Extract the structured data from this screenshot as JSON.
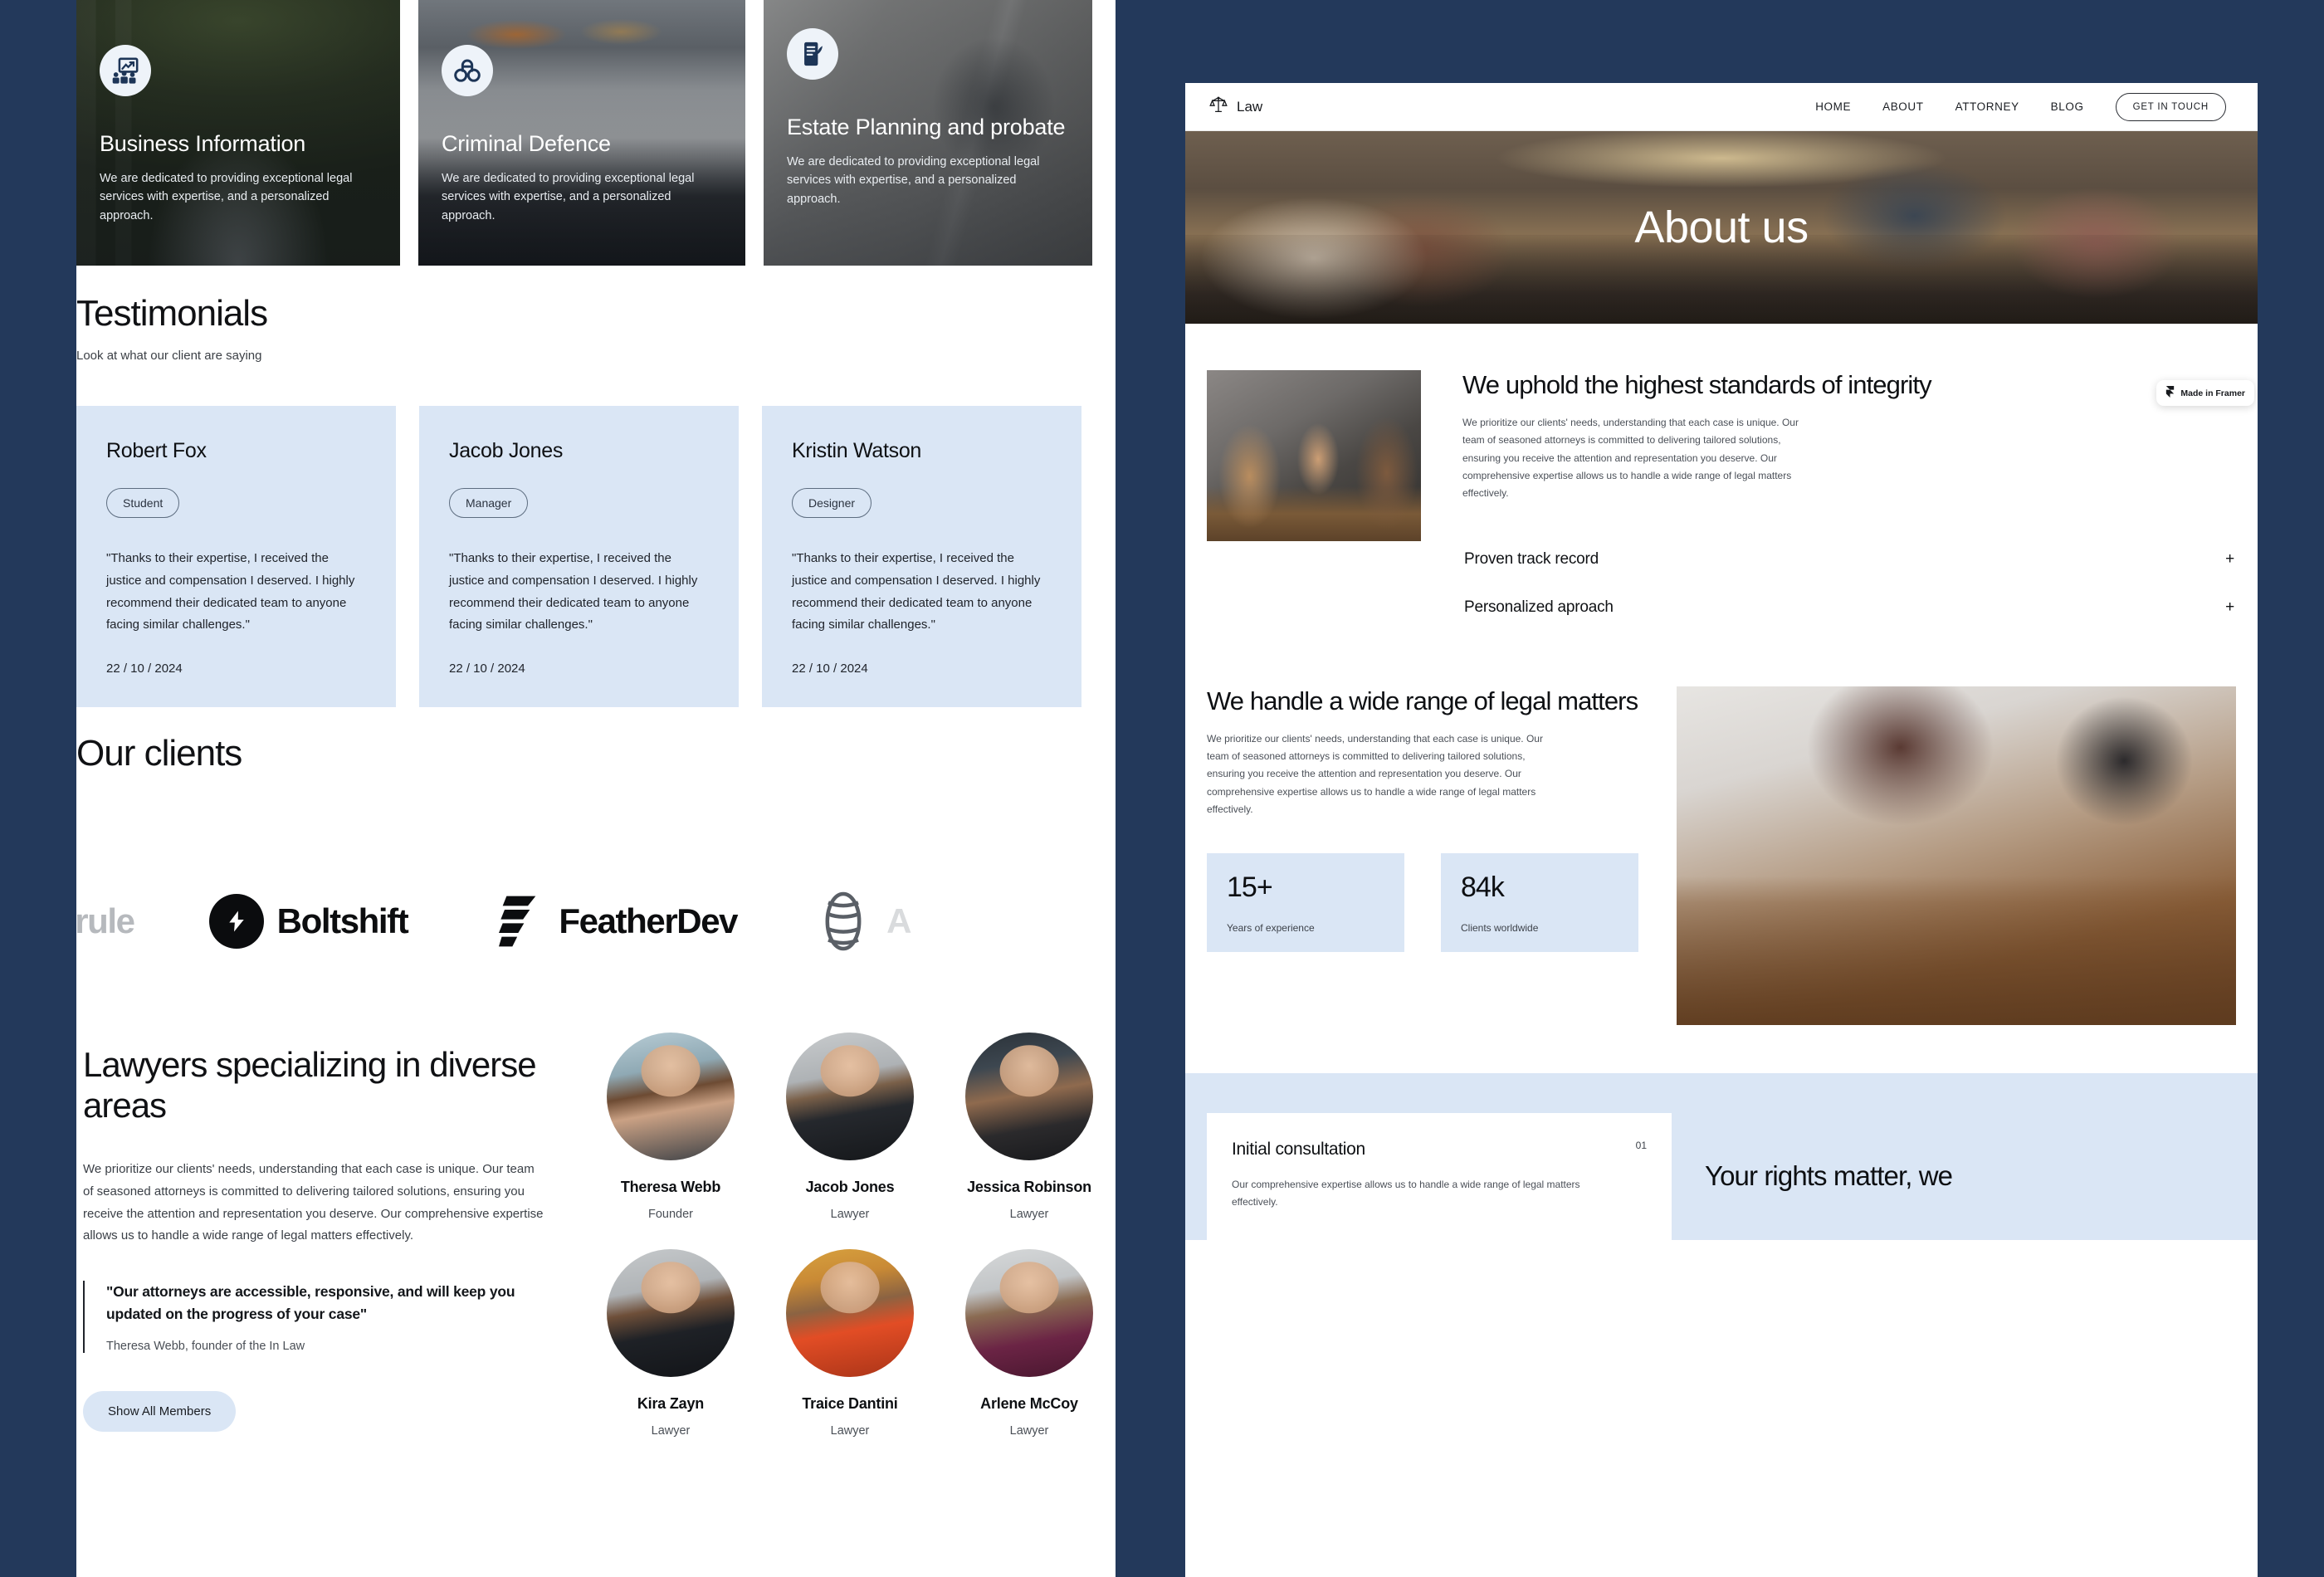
{
  "left_page": {
    "services": [
      {
        "icon": "chart-presentation-people-icon",
        "title": "Business Information",
        "description": "We are dedicated to providing exceptional legal services with expertise, and a personalized approach."
      },
      {
        "icon": "handcuffs-icon",
        "title": "Criminal Defence",
        "description": "We are dedicated to providing exceptional legal services with expertise, and a personalized approach."
      },
      {
        "icon": "signed-document-pen-icon",
        "title": "Estate Planning and probate",
        "description": "We are dedicated to providing exceptional legal services with expertise, and a personalized approach."
      }
    ],
    "testimonials": {
      "heading": "Testimonials",
      "subheading": "Look at what our client are saying",
      "cards": [
        {
          "name": "Robert Fox",
          "role": "Student",
          "quote": "\"Thanks to their expertise, I received the justice and compensation I deserved. I highly recommend their dedicated team to anyone facing similar challenges.\"",
          "date": "22 / 10 / 2024"
        },
        {
          "name": "Jacob Jones",
          "role": "Manager",
          "quote": "\"Thanks to their expertise, I received the justice and compensation I deserved. I highly recommend their dedicated team to anyone facing similar challenges.\"",
          "date": "22 / 10 / 2024"
        },
        {
          "name": "Kristin Watson",
          "role": "Designer",
          "quote": "\"Thanks to their expertise, I received the justice and compensation I deserved. I highly recommend their dedicated team to anyone facing similar challenges.\"",
          "date": "22 / 10 / 2024"
        }
      ]
    },
    "clients": {
      "heading": "Our clients",
      "logos": [
        {
          "name": "herule",
          "mark": "none",
          "clipped": "left"
        },
        {
          "name": "Boltshift",
          "mark": "bolt-circle-icon",
          "clipped": "none"
        },
        {
          "name": "FeatherDev",
          "mark": "feather-stripes-icon",
          "clipped": "none"
        },
        {
          "name": "A",
          "mark": "sphere-lines-icon",
          "clipped": "right"
        }
      ]
    },
    "lawyers": {
      "title": "Lawyers specializing in diverse areas",
      "paragraph": "We prioritize our clients' needs, understanding that each case is unique. Our team of seasoned attorneys is committed to delivering tailored solutions, ensuring you receive the attention and representation you deserve. Our comprehensive expertise allows us to handle a wide range of legal matters effectively.",
      "quote": "\"Our attorneys are accessible, responsive, and will keep you updated on the progress of your case\"",
      "quote_author": "Theresa Webb, founder of the In Law",
      "button": "Show All Members",
      "team": [
        {
          "name": "Theresa Webb",
          "role": "Founder"
        },
        {
          "name": "Jacob Jones",
          "role": "Lawyer"
        },
        {
          "name": "Jessica Robinson",
          "role": "Lawyer"
        },
        {
          "name": "Kira Zayn",
          "role": "Lawyer"
        },
        {
          "name": "Traice Dantini",
          "role": "Lawyer"
        },
        {
          "name": "Arlene McCoy",
          "role": "Lawyer"
        }
      ]
    }
  },
  "right_page": {
    "nav": {
      "logo_icon": "scales-of-justice-icon",
      "brand": "Law",
      "links": [
        "HOME",
        "ABOUT",
        "ATTORNEY",
        "BLOG"
      ],
      "cta": "GET IN TOUCH"
    },
    "hero": {
      "title": "About us",
      "image": "office-meeting-room-photo"
    },
    "integrity": {
      "image": "lawyer-client-consultation-photo",
      "heading": "We uphold the highest standards of integrity",
      "paragraph": "We prioritize our clients' needs, understanding that each case is unique. Our team of seasoned attorneys is committed to delivering tailored solutions, ensuring you receive the attention and representation you deserve. Our comprehensive expertise allows us to handle a wide range of legal matters effectively.",
      "accordion": [
        {
          "label": "Proven track record",
          "toggle": "+"
        },
        {
          "label": "Personalized aproach",
          "toggle": "+"
        }
      ]
    },
    "framer_badge": {
      "label": "Made in Framer",
      "icon": "framer-logo-icon"
    },
    "matters": {
      "heading": "We handle a wide range of legal matters",
      "paragraph": "We prioritize our clients' needs, understanding that each case is unique. Our team of seasoned attorneys is committed to delivering tailored solutions, ensuring you receive the attention and representation you deserve. Our comprehensive expertise allows us to handle a wide range of legal matters effectively.",
      "stats": [
        {
          "value": "15+",
          "label": "Years of experience"
        },
        {
          "value": "84k",
          "label": "Clients worldwide"
        }
      ],
      "image": "law-books-desk-photo"
    },
    "process": {
      "card": {
        "title": "Initial consultation",
        "number": "01",
        "body": "Our comprehensive expertise allows us to handle a wide range of legal matters effectively."
      },
      "cta_title": "Your rights matter, we"
    }
  },
  "colors": {
    "page_background": "#23395b",
    "card_blue": "#dae6f5",
    "text_dark": "#0e1013",
    "panel_white": "#ffffff"
  }
}
